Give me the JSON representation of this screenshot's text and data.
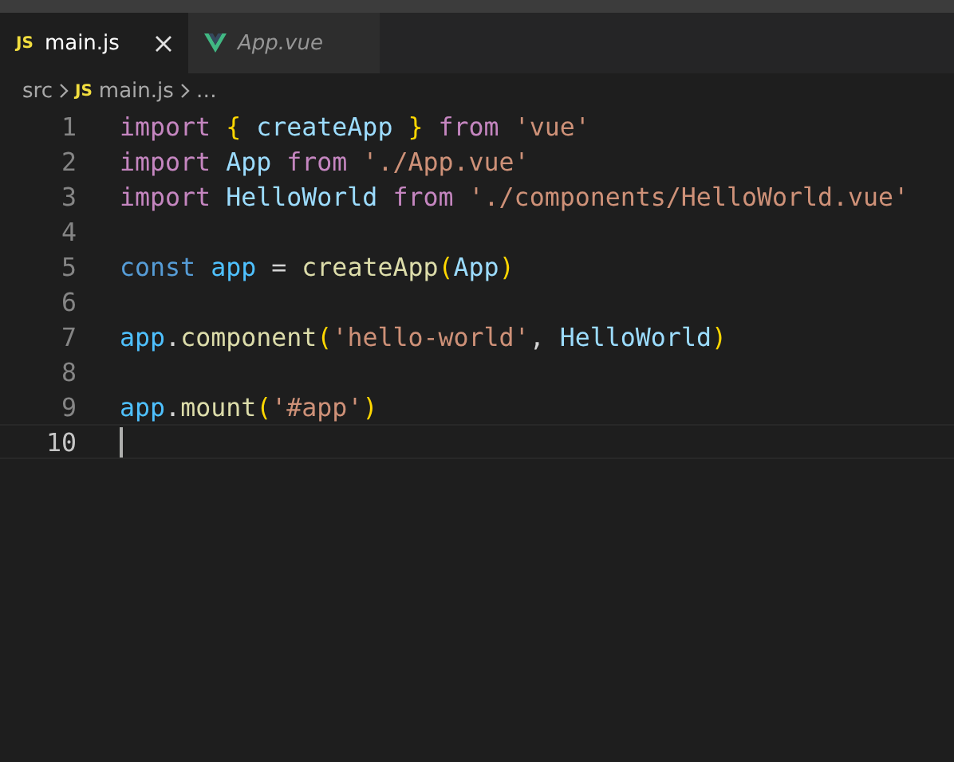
{
  "tabs": [
    {
      "label": "main.js",
      "kind": "js",
      "icon_text": "JS",
      "selected": true,
      "preview": false
    },
    {
      "label": "App.vue",
      "kind": "vue",
      "selected": false,
      "preview": true
    }
  ],
  "breadcrumb": [
    {
      "label": "src"
    },
    {
      "label": "main.js",
      "icon_text": "JS"
    },
    {
      "label": "…"
    }
  ],
  "lines": [
    {
      "number": "1",
      "current": false,
      "tokens": [
        {
          "text": "import ",
          "kind": "keyword"
        },
        {
          "text": "{",
          "kind": "brace"
        },
        {
          "text": " createApp ",
          "kind": "ident"
        },
        {
          "text": "}",
          "kind": "brace"
        },
        {
          "text": " from ",
          "kind": "keyword"
        },
        {
          "text": "'vue'",
          "kind": "string"
        }
      ]
    },
    {
      "number": "2",
      "current": false,
      "tokens": [
        {
          "text": "import",
          "kind": "keyword"
        },
        {
          "text": " App ",
          "kind": "ident"
        },
        {
          "text": "from",
          "kind": "keyword"
        },
        {
          "text": " './App.vue'",
          "kind": "string"
        }
      ]
    },
    {
      "number": "3",
      "current": false,
      "tokens": [
        {
          "text": "import",
          "kind": "keyword"
        },
        {
          "text": " HelloWorld ",
          "kind": "ident"
        },
        {
          "text": "from",
          "kind": "keyword"
        },
        {
          "text": " './components/HelloWorld.vue'",
          "kind": "string"
        }
      ]
    },
    {
      "number": "4",
      "current": false
    },
    {
      "number": "5",
      "current": false,
      "tokens": [
        {
          "text": "const",
          "kind": "storage"
        },
        {
          "text": " app ",
          "kind": "variable"
        },
        {
          "text": "= ",
          "kind": "plain"
        },
        {
          "text": "createApp",
          "kind": "function"
        },
        {
          "text": "(",
          "kind": "brace"
        },
        {
          "text": "App",
          "kind": "ident"
        },
        {
          "text": ")",
          "kind": "brace"
        }
      ]
    },
    {
      "number": "6",
      "current": false
    },
    {
      "number": "7",
      "current": false,
      "tokens": [
        {
          "text": "app",
          "kind": "variable"
        },
        {
          "text": ".",
          "kind": "plain"
        },
        {
          "text": "component",
          "kind": "function"
        },
        {
          "text": "(",
          "kind": "brace"
        },
        {
          "text": "'hello-world'",
          "kind": "string"
        },
        {
          "text": ", ",
          "kind": "plain"
        },
        {
          "text": "HelloWorld",
          "kind": "ident"
        },
        {
          "text": ")",
          "kind": "brace"
        }
      ]
    },
    {
      "number": "8",
      "current": false
    },
    {
      "number": "9",
      "current": false,
      "tokens": [
        {
          "text": "app",
          "kind": "variable"
        },
        {
          "text": ".",
          "kind": "plain"
        },
        {
          "text": "mount",
          "kind": "function"
        },
        {
          "text": "(",
          "kind": "brace"
        },
        {
          "text": "'#app'",
          "kind": "string"
        },
        {
          "text": ")",
          "kind": "brace"
        }
      ]
    },
    {
      "number": "10",
      "current": true
    }
  ]
}
